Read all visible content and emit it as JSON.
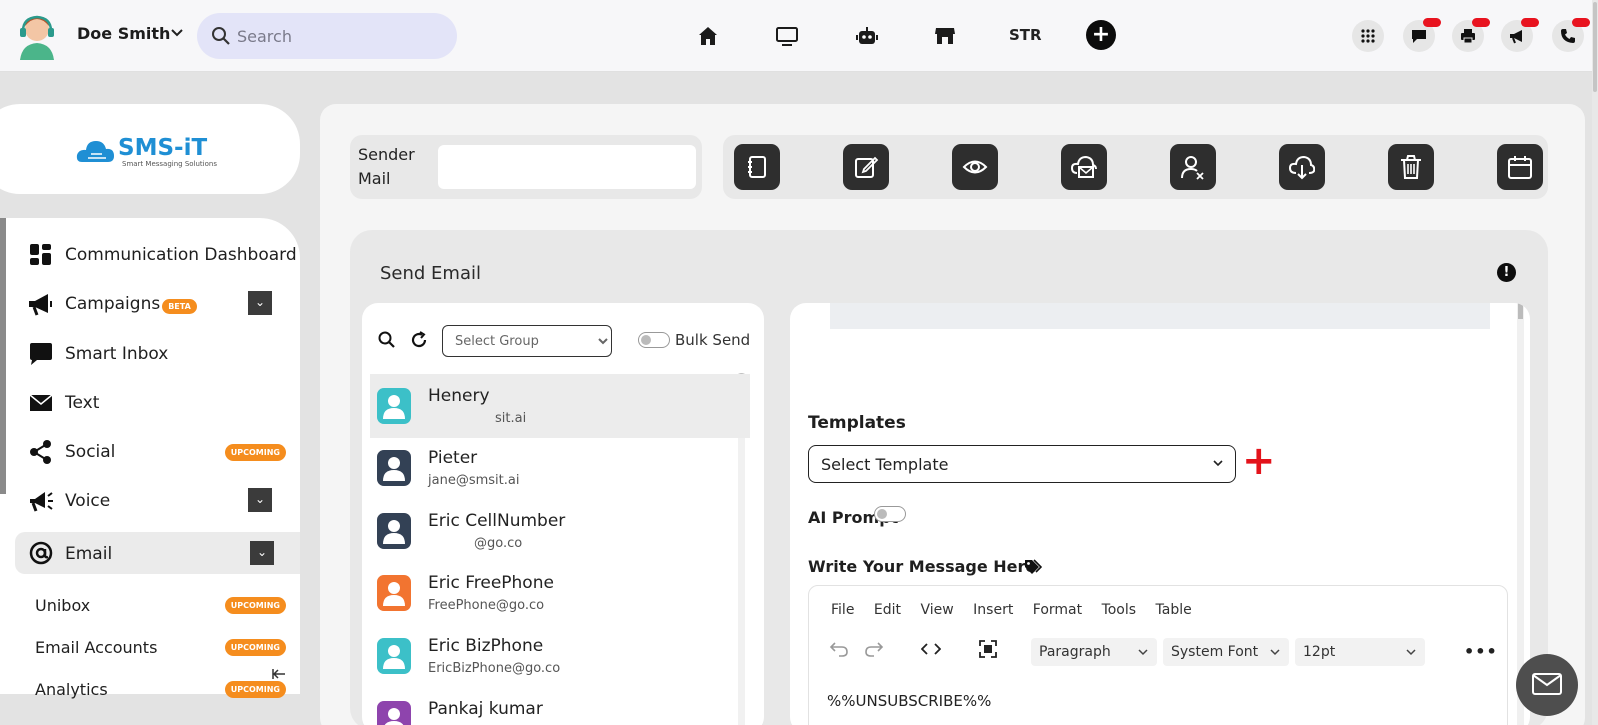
{
  "topbar": {
    "username": "Doe Smith",
    "search_placeholder": "Search",
    "str_label": "STR",
    "plus_label": "+"
  },
  "sidebar": {
    "logo_text": "SMS-iT",
    "logo_tagline": "Smart Messaging Solutions",
    "items": [
      {
        "label": "Communication Dashboard"
      },
      {
        "label": "Campaigns",
        "badge": "BETA"
      },
      {
        "label": "Smart Inbox"
      },
      {
        "label": "Text"
      },
      {
        "label": "Social",
        "badge": "UPCOMING"
      },
      {
        "label": "Voice"
      },
      {
        "label": "Email"
      }
    ],
    "sub_items": [
      {
        "label": "Unibox",
        "badge": "UPCOMING"
      },
      {
        "label": "Email Accounts",
        "badge": "UPCOMING"
      },
      {
        "label": "Analytics",
        "badge": "UPCOMING"
      }
    ],
    "dropdown_glyph": "⌄"
  },
  "sender": {
    "label": "Sender Mail",
    "value": ""
  },
  "send_email": {
    "title": "Send Email",
    "info_glyph": "!"
  },
  "contacts": {
    "group_placeholder": "Select Group",
    "bulk_label": "Bulk Send",
    "rows": [
      {
        "name": "Henery",
        "email": "sit.ai",
        "color": "#3cc0c8"
      },
      {
        "name": "Pieter",
        "email": "jane@smsit.ai",
        "color": "#334155"
      },
      {
        "name": "Eric CellNumber",
        "email": "@go.co",
        "color": "#334155"
      },
      {
        "name": "Eric FreePhone",
        "email": "FreePhone@go.co",
        "color": "#f27430"
      },
      {
        "name": "Eric BizPhone",
        "email": "EricBizPhone@go.co",
        "color": "#3cc0c8"
      },
      {
        "name": "Pankaj kumar",
        "email": "",
        "color": "#8e44ad"
      }
    ]
  },
  "compose": {
    "templates_label": "Templates",
    "template_placeholder": "Select Template",
    "add_glyph": "+",
    "ai_prompt_label": "AI Prompt",
    "message_label": "Write Your Message Here",
    "menu": [
      "File",
      "Edit",
      "View",
      "Insert",
      "Format",
      "Tools",
      "Table"
    ],
    "block_format": "Paragraph",
    "font_family": "System Font",
    "font_size": "12pt",
    "more_glyph": "•••",
    "body_text": "%%UNSUBSCRIBE%%"
  },
  "icons": {
    "nav": [
      "home-icon",
      "monitor-icon",
      "robot-icon",
      "store-icon"
    ],
    "right": [
      "apps-grid-icon",
      "chat-icon",
      "printer-icon",
      "megaphone-icon",
      "phone-icon"
    ],
    "tools": [
      "notebook-icon",
      "edit-icon",
      "eye-icon",
      "cloud-mail-icon",
      "user-remove-icon",
      "cloud-download-icon",
      "trash-icon",
      "calendar-icon"
    ]
  },
  "colors": {
    "accent_orange": "#f58d1e",
    "danger_red": "#e3131b",
    "dark_button": "#2e2e2e",
    "search_bg": "#e3e4f8"
  }
}
